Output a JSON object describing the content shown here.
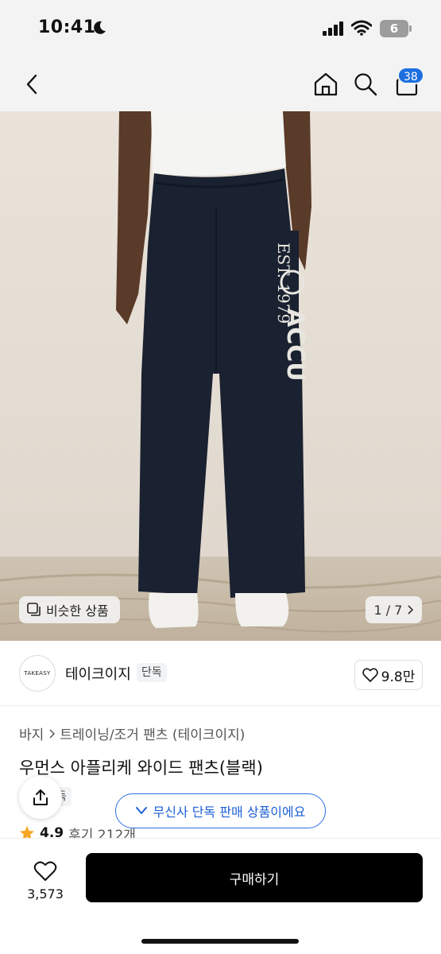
{
  "status_bar": {
    "time": "10:41",
    "battery": "6"
  },
  "nav": {
    "cart_count": "38"
  },
  "image": {
    "similar_label": "비슷한 상품",
    "page_indicator": "1 / 7",
    "print_text_1": "EST. 1979",
    "print_text_2": "ACCU"
  },
  "brand": {
    "logo_text": "TAKEASY",
    "name": "테이크이지",
    "tag": "단독",
    "like_count": "9.8만"
  },
  "breadcrumb": {
    "items": [
      "바지",
      "트레이닝/조거 팬츠 (테이크이지)"
    ]
  },
  "product": {
    "title": "우먼스 아플리케 와이드 팬츠(블랙)",
    "exclusive_tag": "단독",
    "rating": "4.9",
    "review_text": "후기 212개"
  },
  "banner": {
    "text": "무신사 단독 판매 상품이에요"
  },
  "bottom": {
    "wish_count": "3,573",
    "buy_label": "구매하기"
  },
  "colors": {
    "accent_blue": "#1d6fe0",
    "banner_blue": "#2f6fe4",
    "buy_button": "#000000",
    "star": "#f5a623"
  }
}
